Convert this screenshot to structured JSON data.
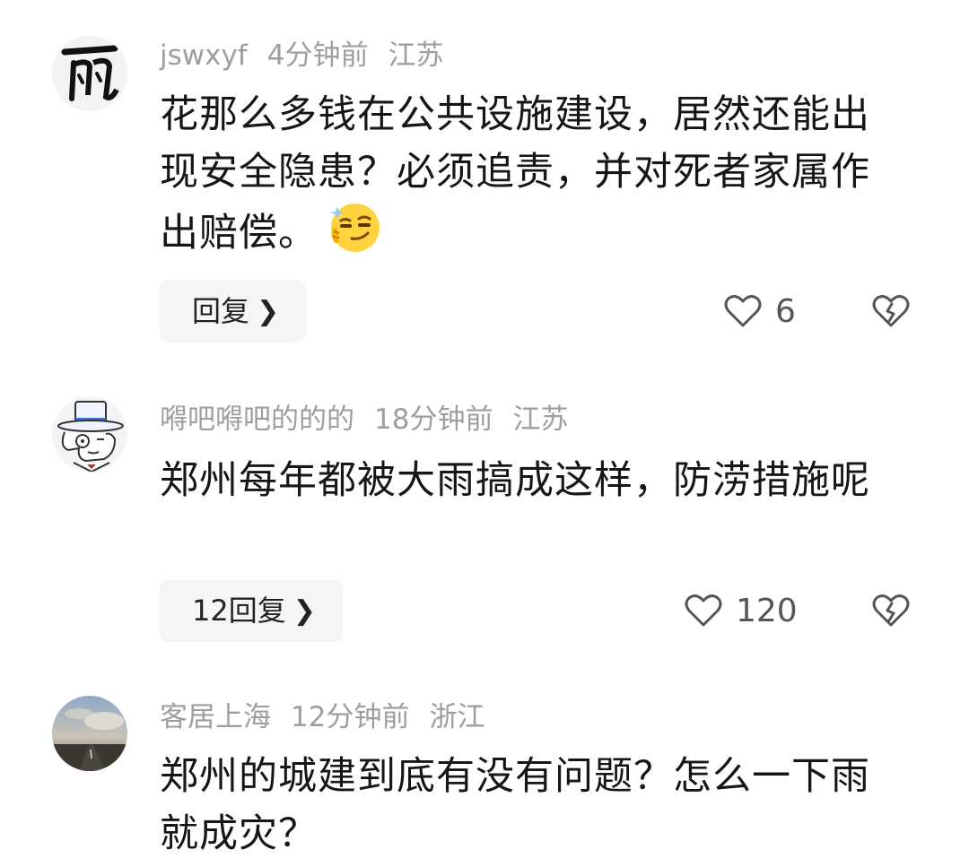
{
  "comments": [
    {
      "username": "jswxyf",
      "time": "4分钟前",
      "location": "江苏",
      "text": "花那么多钱在公共设施建设，居然还能出现安全隐患？必须追责，并对死者家属作出赔偿。",
      "emoji": "smirk-emoji",
      "reply_label": "回复",
      "like_count": "6",
      "avatar": "calligraphy-avatar"
    },
    {
      "username": "嘚吧嘚吧的的的",
      "time": "18分钟前",
      "location": "江苏",
      "text": "郑州每年都被大雨搞成这样，防涝措施呢",
      "reply_label": "12回复",
      "like_count": "120",
      "avatar": "cartoon-detective-avatar"
    },
    {
      "username": "客居上海",
      "time": "12分钟前",
      "location": "浙江",
      "text": "郑州的城建到底有没有问题？怎么一下雨就成灾？",
      "avatar": "sky-road-avatar"
    }
  ],
  "icons": {
    "like": "heart-outline-icon",
    "dislike": "broken-heart-icon",
    "chevron": "chevron-right-icon"
  },
  "colors": {
    "meta_text": "#9e9e9e",
    "body_text": "#161616",
    "reply_bg": "#f4f5f7",
    "icon_stroke": "#555555"
  }
}
